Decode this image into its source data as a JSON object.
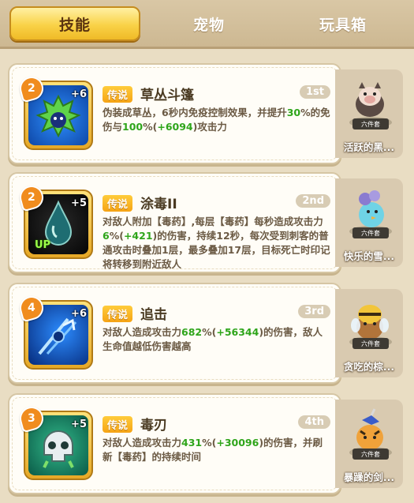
{
  "tabs": [
    {
      "label": "技能",
      "active": true
    },
    {
      "label": "宠物",
      "active": false
    },
    {
      "label": "玩具箱",
      "active": false
    }
  ],
  "skills": [
    {
      "level": "2",
      "plus": "+6",
      "up": "",
      "rarity": "传说",
      "name": "草丛斗篷",
      "rank": "1st",
      "desc_parts": [
        {
          "t": "伪装成草丛，6秒内免疫控制效果，并提升"
        },
        {
          "t": "30",
          "hl": true
        },
        {
          "t": "%的免伤与"
        },
        {
          "t": "100",
          "hl": true
        },
        {
          "t": "%("
        },
        {
          "t": "+6094",
          "hl": true
        },
        {
          "t": ")攻击力"
        }
      ],
      "icon": "bush-creature-icon",
      "pet": {
        "tag": "六件套",
        "name": "活跃的黑...",
        "icon": "boar-pet-icon"
      }
    },
    {
      "level": "2",
      "plus": "+5",
      "up": "UP",
      "rarity": "传说",
      "name": "涂毒II",
      "rank": "2nd",
      "desc_parts": [
        {
          "t": "对敌人附加【毒药】,每层【毒药】每秒造成攻击力"
        },
        {
          "t": "6",
          "hl": true
        },
        {
          "t": "%("
        },
        {
          "t": "+421",
          "hl": true
        },
        {
          "t": ")的伤害，持续12秒，每次受到刺客的普通攻击时叠加1层，最多叠加17层，目标死亡时印记将转移到附近敌人"
        }
      ],
      "icon": "poison-drop-icon",
      "pet": {
        "tag": "六件套",
        "name": "快乐的雪...",
        "icon": "snow-bird-pet-icon"
      }
    },
    {
      "level": "4",
      "plus": "+6",
      "up": "",
      "rarity": "传说",
      "name": "追击",
      "rank": "3rd",
      "desc_parts": [
        {
          "t": "对敌人造成攻击力"
        },
        {
          "t": "682",
          "hl": true
        },
        {
          "t": "%("
        },
        {
          "t": "+56344",
          "hl": true
        },
        {
          "t": ")的伤害，敌人生命值越低伤害越高"
        }
      ],
      "icon": "pursuit-slash-icon",
      "pet": {
        "tag": "六件套",
        "name": "贪吃的棕...",
        "icon": "bee-bear-pet-icon"
      }
    },
    {
      "level": "3",
      "plus": "+5",
      "up": "",
      "rarity": "传说",
      "name": "毒刃",
      "rank": "4th",
      "desc_parts": [
        {
          "t": "对敌人造成攻击力"
        },
        {
          "t": "431",
          "hl": true
        },
        {
          "t": "%("
        },
        {
          "t": "+30096",
          "hl": true
        },
        {
          "t": ")的伤害，并刷新【毒药】的持续时间"
        }
      ],
      "icon": "poison-skull-icon",
      "pet": {
        "tag": "六件套",
        "name": "暴躁的剑...",
        "icon": "tiger-pet-icon"
      }
    }
  ]
}
